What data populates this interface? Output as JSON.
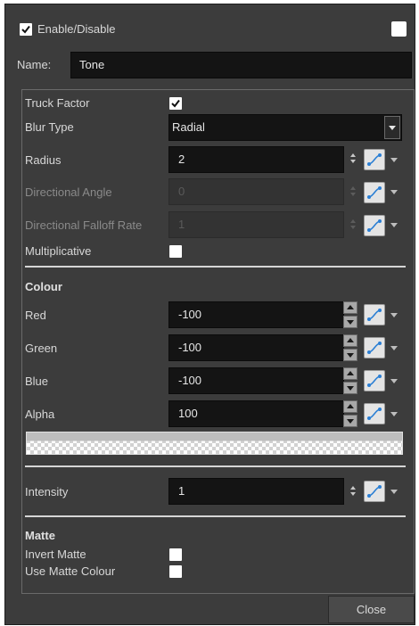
{
  "header": {
    "enable_label": "Enable/Disable",
    "enable_checked": true,
    "corner_checkbox_checked": false,
    "name_label": "Name:",
    "name_value": "Tone"
  },
  "params": {
    "truck_factor": {
      "label": "Truck Factor",
      "checked": true
    },
    "blur_type": {
      "label": "Blur Type",
      "value": "Radial"
    },
    "radius": {
      "label": "Radius",
      "value": "2"
    },
    "directional_angle": {
      "label": "Directional Angle",
      "value": "0",
      "disabled": true
    },
    "directional_falloff_rate": {
      "label": "Directional Falloff Rate",
      "value": "1",
      "disabled": true
    },
    "multiplicative": {
      "label": "Multiplicative",
      "checked": false
    }
  },
  "colour": {
    "heading": "Colour",
    "red": {
      "label": "Red",
      "value": "-100"
    },
    "green": {
      "label": "Green",
      "value": "-100"
    },
    "blue": {
      "label": "Blue",
      "value": "-100"
    },
    "alpha": {
      "label": "Alpha",
      "value": "100"
    },
    "swatch_color": "#bdbdbd"
  },
  "intensity": {
    "label": "Intensity",
    "value": "1"
  },
  "matte": {
    "heading": "Matte",
    "invert_matte": {
      "label": "Invert Matte",
      "checked": false
    },
    "use_matte_colour": {
      "label": "Use Matte Colour",
      "checked": false
    }
  },
  "footer": {
    "close_label": "Close"
  },
  "icons": {
    "checkmark": "checkmark-icon",
    "dropdown": "chevron-down-icon",
    "function_curve": "function-curve-icon",
    "spinner": "spinner-arrows-icon"
  },
  "colors": {
    "window_bg": "#3c3c3c",
    "field_bg": "#141414",
    "curve_accent": "#2b7fd4"
  }
}
